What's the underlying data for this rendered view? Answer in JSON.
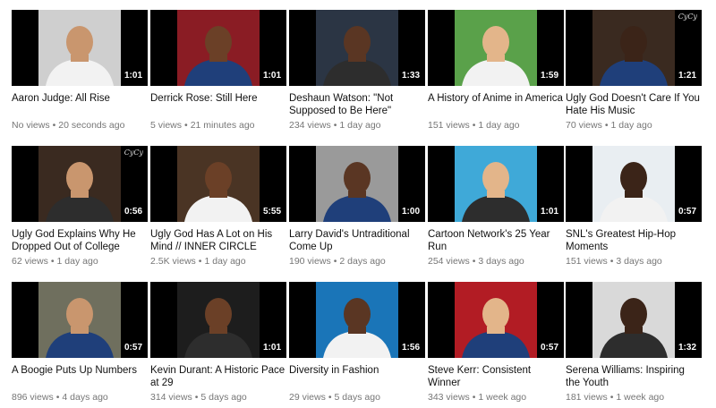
{
  "videos": [
    {
      "title": "Aaron Judge: All Rise",
      "views": "No views",
      "age": "20 seconds ago",
      "duration": "1:01",
      "thumb_color": "#cfcfcf",
      "watermark": ""
    },
    {
      "title": "Derrick Rose: Still Here",
      "views": "5 views",
      "age": "21 minutes ago",
      "duration": "1:01",
      "thumb_color": "#8a1c24",
      "watermark": ""
    },
    {
      "title": "Deshaun Watson: \"Not Supposed to Be Here\"",
      "views": "234 views",
      "age": "1 day ago",
      "duration": "1:33",
      "thumb_color": "#2b3544",
      "watermark": ""
    },
    {
      "title": "A History of Anime in America",
      "views": "151 views",
      "age": "1 day ago",
      "duration": "1:59",
      "thumb_color": "#5aa14a",
      "watermark": ""
    },
    {
      "title": "Ugly God Doesn't Care If You Hate His Music",
      "views": "70 views",
      "age": "1 day ago",
      "duration": "1:21",
      "thumb_color": "#3a2a20",
      "watermark": "CyCy"
    },
    {
      "title": "Ugly God Explains Why He Dropped Out of College",
      "views": "62 views",
      "age": "1 day ago",
      "duration": "0:56",
      "thumb_color": "#3a2a20",
      "watermark": "CyCy"
    },
    {
      "title": "Ugly God Has A Lot on His Mind // INNER CIRCLE",
      "views": "2.5K views",
      "age": "1 day ago",
      "duration": "5:55",
      "thumb_color": "#4a3424",
      "watermark": ""
    },
    {
      "title": "Larry David's Untraditional Come Up",
      "views": "190 views",
      "age": "2 days ago",
      "duration": "1:00",
      "thumb_color": "#9a9a9a",
      "watermark": ""
    },
    {
      "title": "Cartoon Network's 25 Year Run",
      "views": "254 views",
      "age": "3 days ago",
      "duration": "1:01",
      "thumb_color": "#3fa9d8",
      "watermark": ""
    },
    {
      "title": "SNL's Greatest Hip-Hop Moments",
      "views": "151 views",
      "age": "3 days ago",
      "duration": "0:57",
      "thumb_color": "#e9eef2",
      "watermark": ""
    },
    {
      "title": "A Boogie Puts Up Numbers",
      "views": "896 views",
      "age": "4 days ago",
      "duration": "0:57",
      "thumb_color": "#6f6f5e",
      "watermark": ""
    },
    {
      "title": "Kevin Durant: A Historic Pace at 29",
      "views": "314 views",
      "age": "5 days ago",
      "duration": "1:01",
      "thumb_color": "#1d1d1d",
      "watermark": ""
    },
    {
      "title": "Diversity in Fashion",
      "views": "29 views",
      "age": "5 days ago",
      "duration": "1:56",
      "thumb_color": "#1a75b8",
      "watermark": ""
    },
    {
      "title": "Steve Kerr: Consistent Winner",
      "views": "343 views",
      "age": "1 week ago",
      "duration": "0:57",
      "thumb_color": "#b21c24",
      "watermark": ""
    },
    {
      "title": "Serena Williams: Inspiring the Youth",
      "views": "181 views",
      "age": "1 week ago",
      "duration": "1:32",
      "thumb_color": "#d9d9d9",
      "watermark": ""
    }
  ]
}
